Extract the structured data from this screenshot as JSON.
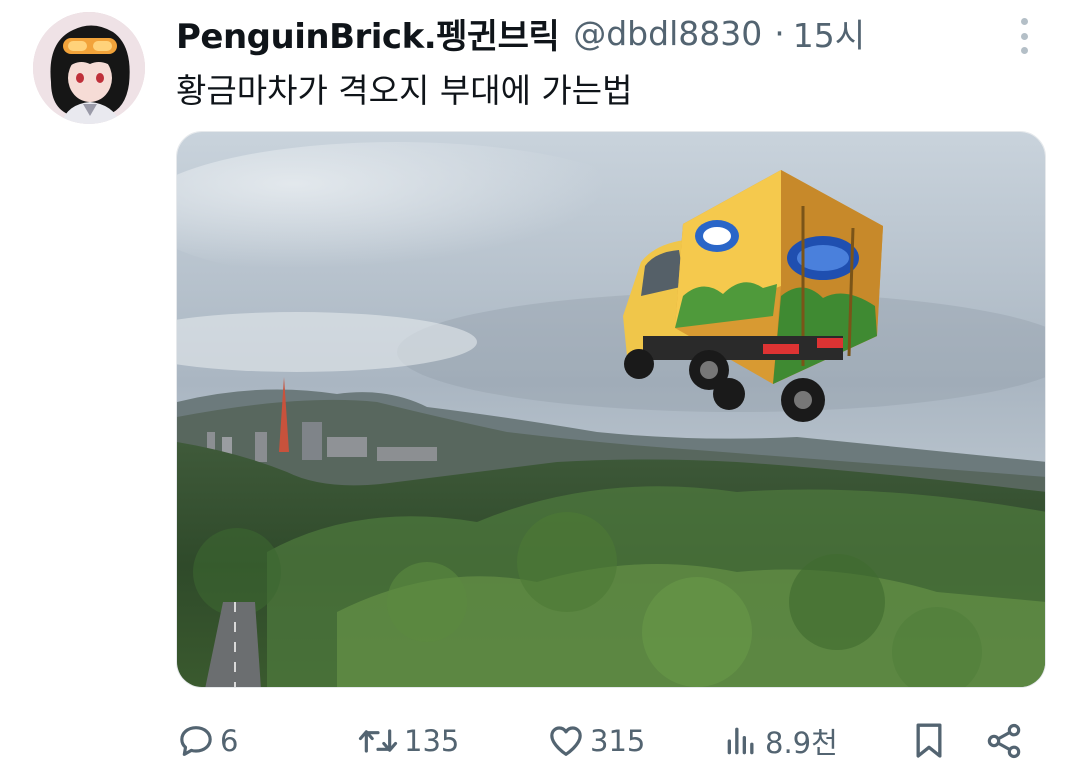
{
  "tweet": {
    "display_name": "PenguinBrick.펭귄브릭",
    "handle": "@dbdl8830",
    "separator": "·",
    "time": "15시",
    "text": "황금마차가 격오지 부대에 가는법"
  },
  "actions": {
    "replies": "6",
    "retweets": "135",
    "likes": "315",
    "views": "8.9천"
  },
  "colors": {
    "text": "#0f1419",
    "muted": "#536471"
  },
  "icons": {
    "reply": "speech-bubble-icon",
    "retweet": "retweet-icon",
    "like": "heart-icon",
    "views": "bar-chart-icon",
    "bookmark": "bookmark-icon",
    "share": "share-icon",
    "more": "vertical-dots-icon"
  }
}
